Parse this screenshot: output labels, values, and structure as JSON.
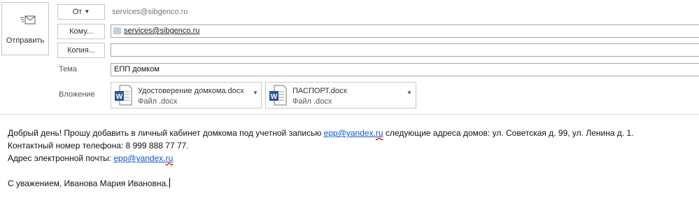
{
  "send": {
    "label": "Отправить",
    "icon": "send-envelope-icon"
  },
  "header": {
    "from_button": "От",
    "from_value": "services@sibgenco.ru",
    "to_button": "Кому...",
    "to_recipient": "services@sibgenco.ru",
    "cc_button": "Копия...",
    "cc_value": "",
    "subject_label": "Тема",
    "subject_value": "ЕПП домком",
    "attach_label": "Вложение"
  },
  "attachments": [
    {
      "name": "Удостоверение домкома.docx",
      "type": "Файл .docx",
      "icon": "word-document-icon"
    },
    {
      "name": "ПАСПОРТ.docx",
      "type": "Файл .docx",
      "icon": "word-document-icon"
    }
  ],
  "body": {
    "line1_pre": "Добрый день! Прошу добавить в личный кабинет домкома под учетной записью ",
    "line1_email_user": "epp@yandex.",
    "line1_email_tld": "ru",
    "line1_post": " следующие адреса домов: ул. Советская д. 99, ул. Ленина д. 1.",
    "line2": "Контактный номер телефона: 8 999 888 77 77.",
    "line3_pre": "Адрес электронной почты: ",
    "line3_email_user": "epp@yandex.",
    "line3_email_tld": "ru",
    "signature": "С уважением, Иванова Мария Ивановна."
  },
  "colors": {
    "link": "#1155cc",
    "border": "#a6a6a6",
    "word_blue": "#2b579a"
  }
}
